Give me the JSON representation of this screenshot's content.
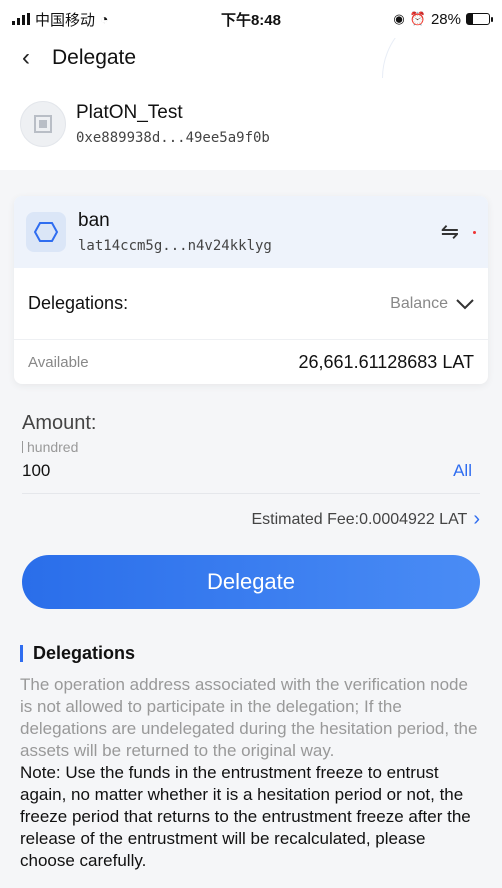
{
  "status": {
    "carrier": "中国移动",
    "time": "下午8:48",
    "battery": "28%"
  },
  "nav": {
    "title": "Delegate"
  },
  "wallet": {
    "name": "PlatON_Test",
    "address": "0xe889938d...49ee5a9f0b"
  },
  "node": {
    "name": "ban",
    "address": "lat14ccm5g...n4v24kklyg"
  },
  "delegations": {
    "label": "Delegations:",
    "select_value": "Balance",
    "available_label": "Available",
    "available_value": "26,661.61128683 LAT"
  },
  "amount": {
    "label": "Amount:",
    "hint": "hundred",
    "value": "100",
    "all_label": "All"
  },
  "fee": {
    "text": "Estimated Fee:0.0004922 LAT"
  },
  "button": {
    "label": "Delegate"
  },
  "notes": {
    "title": "Delegations",
    "grey_text": "The operation address associated with the verification node is not allowed to participate in the delegation; If the delegations are undelegated during the hesitation period, the assets will be returned to the original way.",
    "dark_text": "Note: Use the funds in the entrustment freeze to entrust again, no matter whether it is a hesitation period or not, the freeze period that returns to the entrustment freeze after the release of the entrustment will be recalculated, please choose carefully."
  },
  "colors": {
    "accent": "#2f6df0",
    "button_start": "#2a6eea",
    "button_end": "#4a8cf5"
  }
}
